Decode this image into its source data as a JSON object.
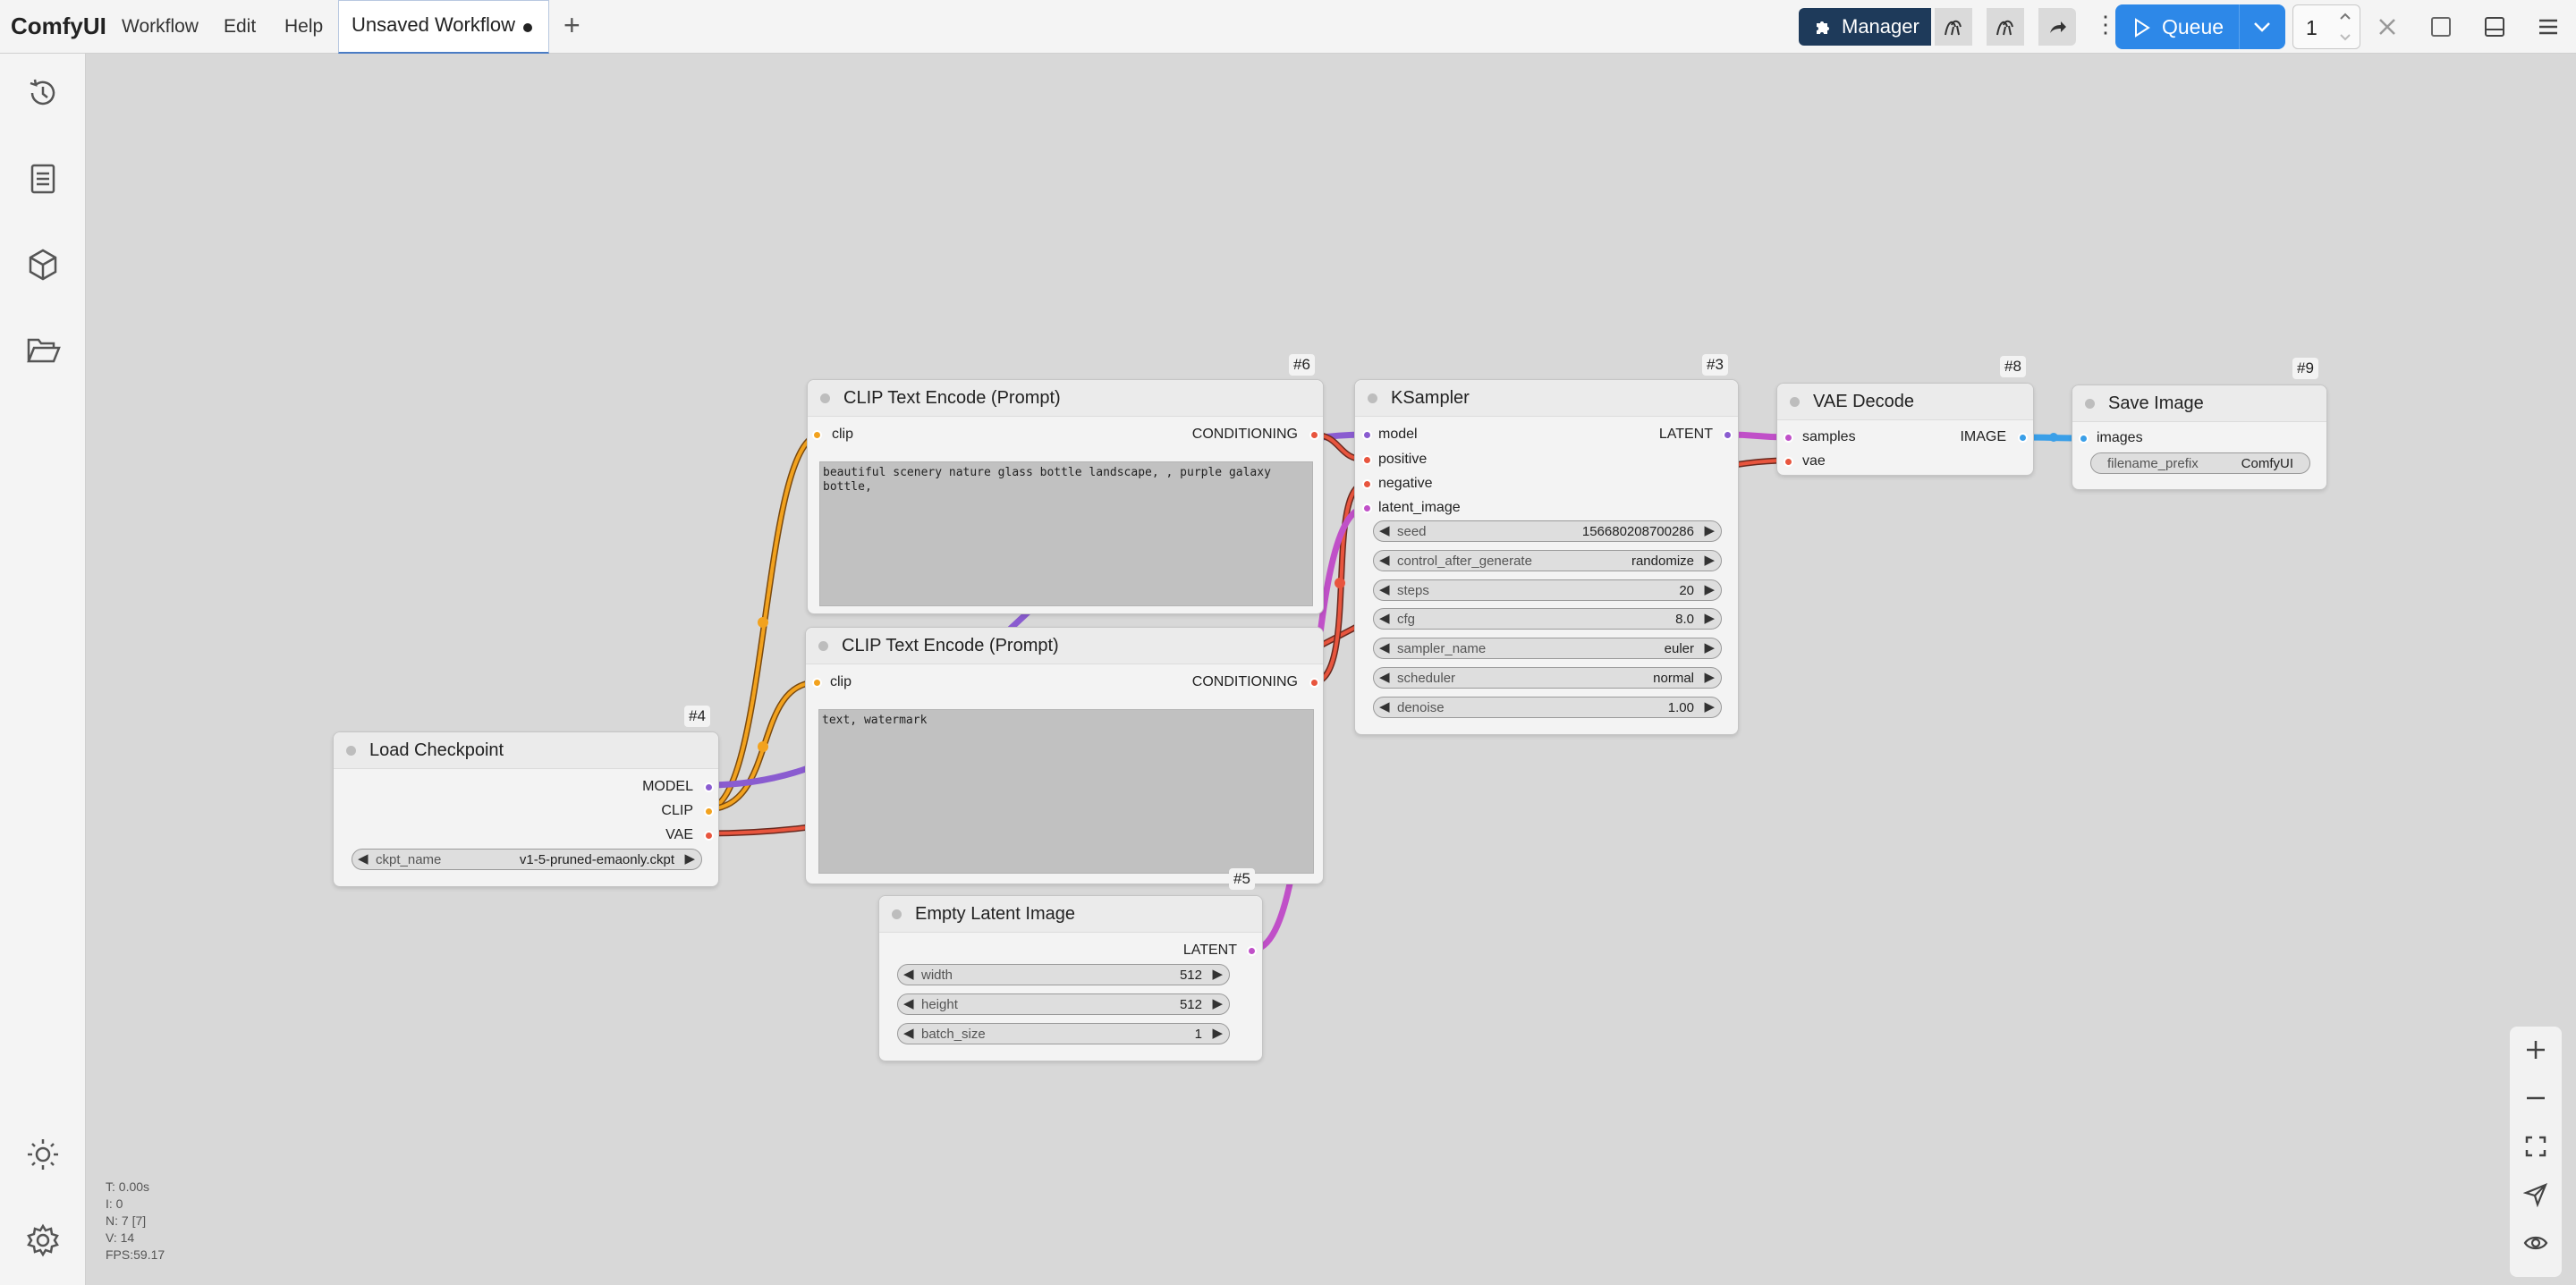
{
  "app": {
    "logo": "ComfyUI"
  },
  "menu": [
    "Workflow",
    "Edit",
    "Help"
  ],
  "tab": {
    "title": "Unsaved Workflow"
  },
  "toolbar": {
    "manager_label": "Manager",
    "queue_label": "Queue",
    "queue_count": "1"
  },
  "stats": [
    "T: 0.00s",
    "I: 0",
    "N: 7 [7]",
    "V: 14",
    "FPS:59.17"
  ],
  "slot_colors": {
    "model": "#8a5cd0",
    "clip": "#f2a21e",
    "vae": "#e8553e",
    "conditioning": "#e8553e",
    "latent": "#c050c8",
    "image": "#3a9fe8"
  },
  "nodes": {
    "clip_pos": {
      "id": "#6",
      "title": "CLIP Text Encode (Prompt)",
      "input": "clip",
      "output": "CONDITIONING",
      "text": "beautiful scenery nature glass bottle landscape, , purple galaxy bottle,"
    },
    "clip_neg": {
      "id": "",
      "title": "CLIP Text Encode (Prompt)",
      "input": "clip",
      "output": "CONDITIONING",
      "text": "text, watermark"
    },
    "ksampler": {
      "id": "#3",
      "title": "KSampler",
      "inputs": [
        "model",
        "positive",
        "negative",
        "latent_image"
      ],
      "output": "LATENT",
      "widgets": [
        {
          "label": "seed",
          "value": "156680208700286"
        },
        {
          "label": "control_after_generate",
          "value": "randomize"
        },
        {
          "label": "steps",
          "value": "20"
        },
        {
          "label": "cfg",
          "value": "8.0"
        },
        {
          "label": "sampler_name",
          "value": "euler"
        },
        {
          "label": "scheduler",
          "value": "normal"
        },
        {
          "label": "denoise",
          "value": "1.00"
        }
      ]
    },
    "vae_decode": {
      "id": "#8",
      "title": "VAE Decode",
      "inputs": [
        "samples",
        "vae"
      ],
      "output": "IMAGE"
    },
    "save_image": {
      "id": "#9",
      "title": "Save Image",
      "input": "images",
      "widget": {
        "label": "filename_prefix",
        "value": "ComfyUI"
      }
    },
    "checkpoint": {
      "id": "#4",
      "title": "Load Checkpoint",
      "outputs": [
        "MODEL",
        "CLIP",
        "VAE"
      ],
      "widget": {
        "label": "ckpt_name",
        "value": "v1-5-pruned-emaonly.ckpt"
      }
    },
    "latent": {
      "id": "#5",
      "title": "Empty Latent Image",
      "output": "LATENT",
      "widgets": [
        {
          "label": "width",
          "value": "512"
        },
        {
          "label": "height",
          "value": "512"
        },
        {
          "label": "batch_size",
          "value": "1"
        }
      ]
    }
  }
}
